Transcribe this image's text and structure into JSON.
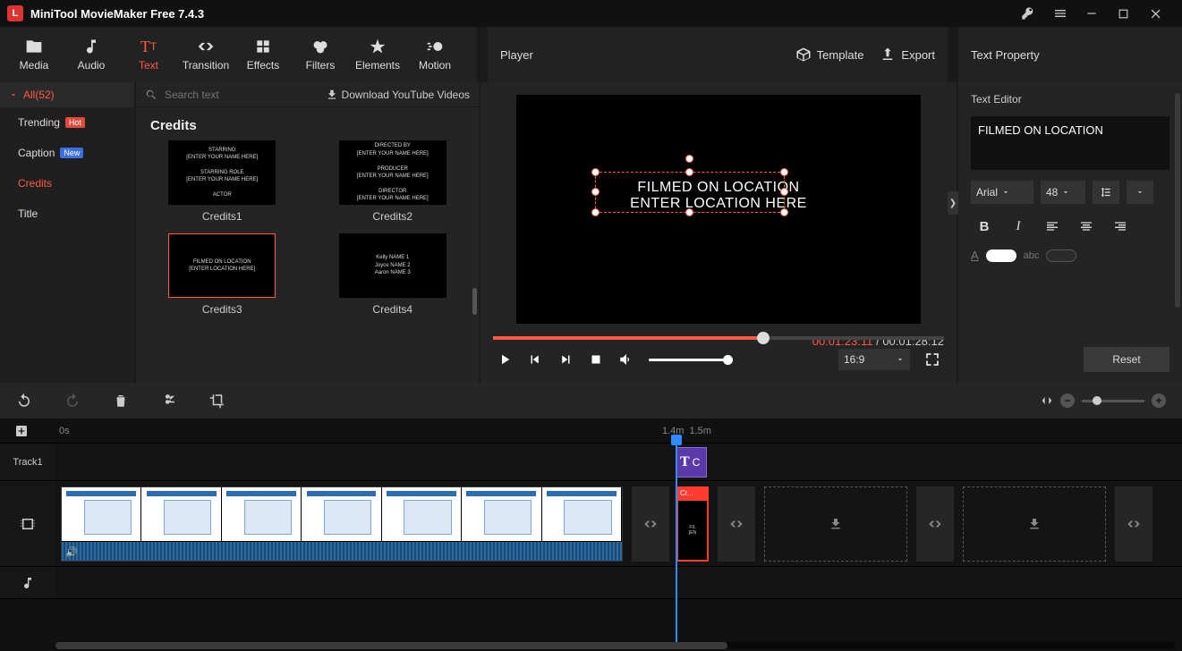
{
  "app": {
    "title": "MiniTool MovieMaker Free 7.4.3"
  },
  "ribbon": {
    "tabs": [
      {
        "id": "media",
        "label": "Media"
      },
      {
        "id": "audio",
        "label": "Audio"
      },
      {
        "id": "text",
        "label": "Text"
      },
      {
        "id": "transition",
        "label": "Transition"
      },
      {
        "id": "effects",
        "label": "Effects"
      },
      {
        "id": "filters",
        "label": "Filters"
      },
      {
        "id": "elements",
        "label": "Elements"
      },
      {
        "id": "motion",
        "label": "Motion"
      }
    ],
    "active": "text"
  },
  "player_header": {
    "title": "Player",
    "template": "Template",
    "export": "Export"
  },
  "prop_header": "Text Property",
  "categories": {
    "all_label": "All(52)",
    "items": [
      {
        "label": "Trending",
        "badge": "Hot",
        "badge_cls": "hot"
      },
      {
        "label": "Caption",
        "badge": "New",
        "badge_cls": "new"
      },
      {
        "label": "Credits",
        "active": true
      },
      {
        "label": "Title"
      }
    ]
  },
  "thumbs": {
    "search_placeholder": "Search text",
    "download_label": "Download YouTube Videos",
    "section": "Credits",
    "items": [
      {
        "label": "Credits1",
        "lines": [
          "STARRING",
          "[ENTER YOUR NAME HERE]",
          "",
          "STARRING ROLE",
          "[ENTER YOUR NAME HERE]",
          "",
          "ACTOR"
        ]
      },
      {
        "label": "Credits2",
        "lines": [
          "DIRECTED BY",
          "[ENTER YOUR NAME HERE]",
          "",
          "PRODUCER",
          "[ENTER YOUR NAME HERE]",
          "",
          "DIRECTOR",
          "[ENTER YOUR NAME HERE]"
        ]
      },
      {
        "label": "Credits3",
        "selected": true,
        "lines": [
          "FILMED ON LOCATION",
          "[ENTER LOCATION HERE]"
        ]
      },
      {
        "label": "Credits4",
        "lines": [
          "Kelly NAME 1",
          "Joyce NAME 2",
          "Aaron NAME 3"
        ]
      }
    ]
  },
  "player": {
    "overlay_line1": "FILMED ON LOCATION",
    "overlay_line2": "ENTER LOCATION HERE",
    "current_time": "00:01:23:11",
    "total_time": "00:01:28:12",
    "progress_pct": 60,
    "aspect": "16:9"
  },
  "text_editor": {
    "heading": "Text Editor",
    "value": "FILMED ON LOCATION",
    "font": "Arial",
    "size": "48",
    "text_color": "#ffffff",
    "bg_label": "abc",
    "reset": "Reset"
  },
  "timeline": {
    "zero": "0s",
    "mark1": "1.4m",
    "mark2": "1.5m",
    "track1_label": "Track1",
    "text_clip_label": "C",
    "credits_tag": "Cr..."
  }
}
